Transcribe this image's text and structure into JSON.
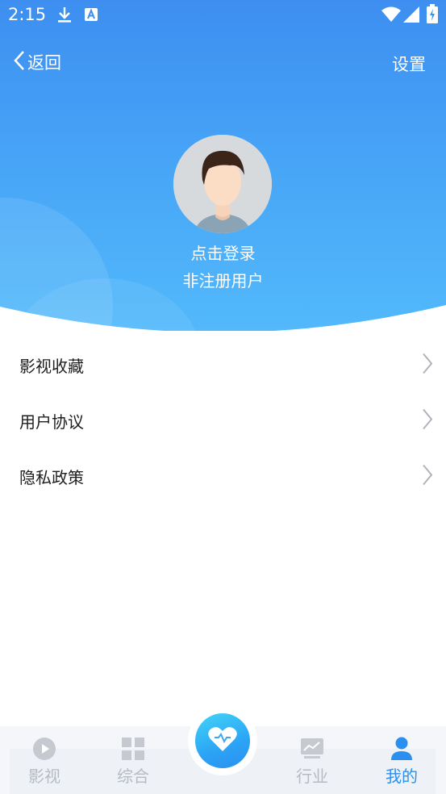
{
  "status_bar": {
    "time": "2:15"
  },
  "nav": {
    "back_label": "返回",
    "settings_label": "设置"
  },
  "profile": {
    "login_text": "点击登录",
    "user_status": "非注册用户"
  },
  "menu": {
    "items": [
      {
        "label": "影视收藏"
      },
      {
        "label": "用户协议"
      },
      {
        "label": "隐私政策"
      }
    ]
  },
  "bottom_nav": {
    "tabs": [
      {
        "label": "影视",
        "icon": "play-icon"
      },
      {
        "label": "综合",
        "icon": "grid-icon"
      },
      {
        "label": "",
        "icon": "heart-icon"
      },
      {
        "label": "行业",
        "icon": "chart-icon"
      },
      {
        "label": "我的",
        "icon": "person-icon"
      }
    ],
    "active": "我的"
  },
  "colors": {
    "header_top": "#3d8ef0",
    "header_bottom": "#52b9fb",
    "active_tab": "#2b8ff0",
    "inactive_tab": "#b6bbc3"
  }
}
